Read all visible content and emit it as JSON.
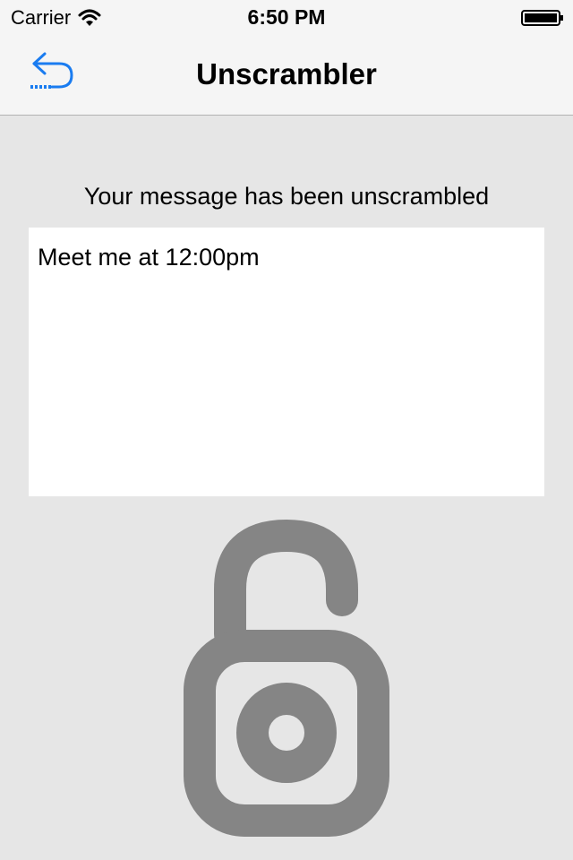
{
  "status_bar": {
    "carrier": "Carrier",
    "time": "6:50 PM",
    "icons": [
      "wifi-icon",
      "battery-icon"
    ]
  },
  "nav": {
    "title": "Unscrambler",
    "back_icon": "back-arrow-icon",
    "accent_color": "#1a7cf0"
  },
  "content": {
    "heading": "Your message has been unscrambled",
    "message": "Meet me at 12:00pm",
    "lock_icon": "unlocked-padlock-icon",
    "lock_color": "#858585"
  },
  "colors": {
    "background": "#e6e6e6",
    "bar_background": "#f5f5f5"
  }
}
